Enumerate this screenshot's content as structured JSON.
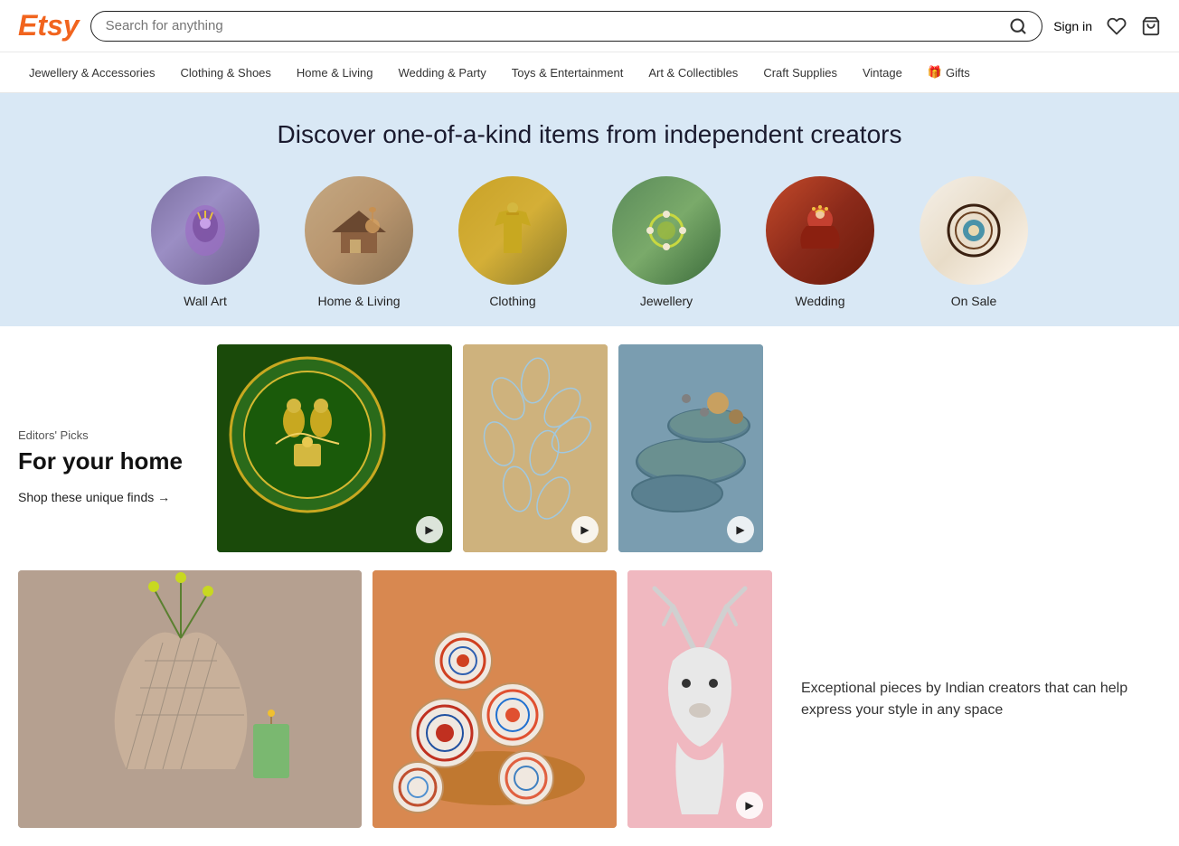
{
  "header": {
    "logo": "Etsy",
    "search_placeholder": "Search for anything",
    "sign_in": "Sign in"
  },
  "nav": {
    "items": [
      {
        "label": "Jewellery & Accessories"
      },
      {
        "label": "Clothing & Shoes"
      },
      {
        "label": "Home & Living"
      },
      {
        "label": "Wedding & Party"
      },
      {
        "label": "Toys & Entertainment"
      },
      {
        "label": "Art & Collectibles"
      },
      {
        "label": "Craft Supplies"
      },
      {
        "label": "Vintage"
      },
      {
        "label": "Gifts"
      }
    ]
  },
  "hero": {
    "title": "Discover one-of-a-kind items from independent creators"
  },
  "categories": [
    {
      "label": "Wall Art",
      "class": "cat-wall-art"
    },
    {
      "label": "Home & Living",
      "class": "cat-home"
    },
    {
      "label": "Clothing",
      "class": "cat-clothing"
    },
    {
      "label": "Jewellery",
      "class": "cat-jewellery"
    },
    {
      "label": "Wedding",
      "class": "cat-wedding"
    },
    {
      "label": "On Sale",
      "class": "cat-onsale"
    }
  ],
  "editors": {
    "tag": "Editors' Picks",
    "title": "For your home",
    "shop_link": "Shop these unique finds →"
  },
  "bottom_text": "Exceptional pieces by Indian creators that can help express your style in any space"
}
